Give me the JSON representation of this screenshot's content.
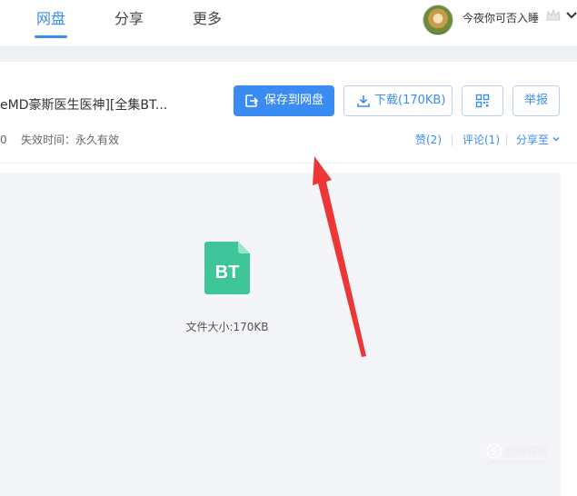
{
  "nav": {
    "tabs": [
      {
        "label": "网盘",
        "active": true
      },
      {
        "label": "分享",
        "active": false
      },
      {
        "label": "更多",
        "active": false
      }
    ],
    "user": {
      "name": "今夜你可否入睡"
    }
  },
  "file": {
    "title": "eMD豪斯医生医神][全集BT...",
    "meta_left": "0",
    "expiry": "失效时间：永久有效"
  },
  "toolbar": {
    "save_label": "保存到网盘",
    "download_label": "下载(170KB)",
    "report_label": "举报"
  },
  "social": {
    "like_label": "赞(2)",
    "comment_label": "评论(1)",
    "share_label": "分享至"
  },
  "preview": {
    "file_type": "BT",
    "size_label": "文件大小:170KB"
  },
  "watermark": {
    "text": "搜狗指南",
    "sub": "zhinan.sogou.com"
  },
  "colors": {
    "accent": "#3b8cf2",
    "file_icon": "#3fc59a",
    "arrow": "#ee3636"
  }
}
